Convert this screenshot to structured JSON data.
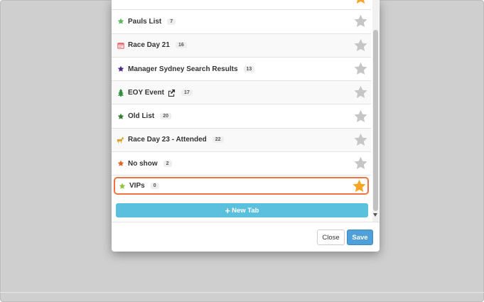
{
  "tabs": [
    {
      "label": "",
      "count": "",
      "icon": "",
      "icon_color": "",
      "starred": true
    },
    {
      "label": "Pauls List",
      "count": "7",
      "icon": "star-icon",
      "icon_color": "#5cb85c",
      "starred": false
    },
    {
      "label": "Race Day 21",
      "count": "16",
      "icon": "calendar-icon",
      "icon_color": "#e8666d",
      "starred": false
    },
    {
      "label": "Manager Sydney Search Results",
      "count": "13",
      "icon": "star-icon",
      "icon_color": "#4b2a86",
      "starred": false
    },
    {
      "label": "EOY Event",
      "count": "17",
      "icon": "tree-icon",
      "icon_color": "#2e8b3e",
      "starred": false,
      "shared": true
    },
    {
      "label": "Old List",
      "count": "20",
      "icon": "star-icon",
      "icon_color": "#2f7d32",
      "starred": false
    },
    {
      "label": "Race Day 23 - Attended",
      "count": "22",
      "icon": "horse-icon",
      "icon_color": "#d9a020",
      "starred": false
    },
    {
      "label": "No show",
      "count": "2",
      "icon": "star-icon",
      "icon_color": "#e0632a",
      "starred": false
    },
    {
      "label": "VIPs",
      "count": "0",
      "icon": "star-icon",
      "icon_color": "#8cc63f",
      "starred": true
    }
  ],
  "new_tab_label": "New Tab",
  "footer": {
    "close_label": "Close",
    "save_label": "Save"
  },
  "colors": {
    "star_on": "#f5a623",
    "star_off": "#c6c6c6",
    "highlight": "#f07240",
    "new_tab_bg": "#5bc0de",
    "save_bg": "#4f9fd8"
  }
}
